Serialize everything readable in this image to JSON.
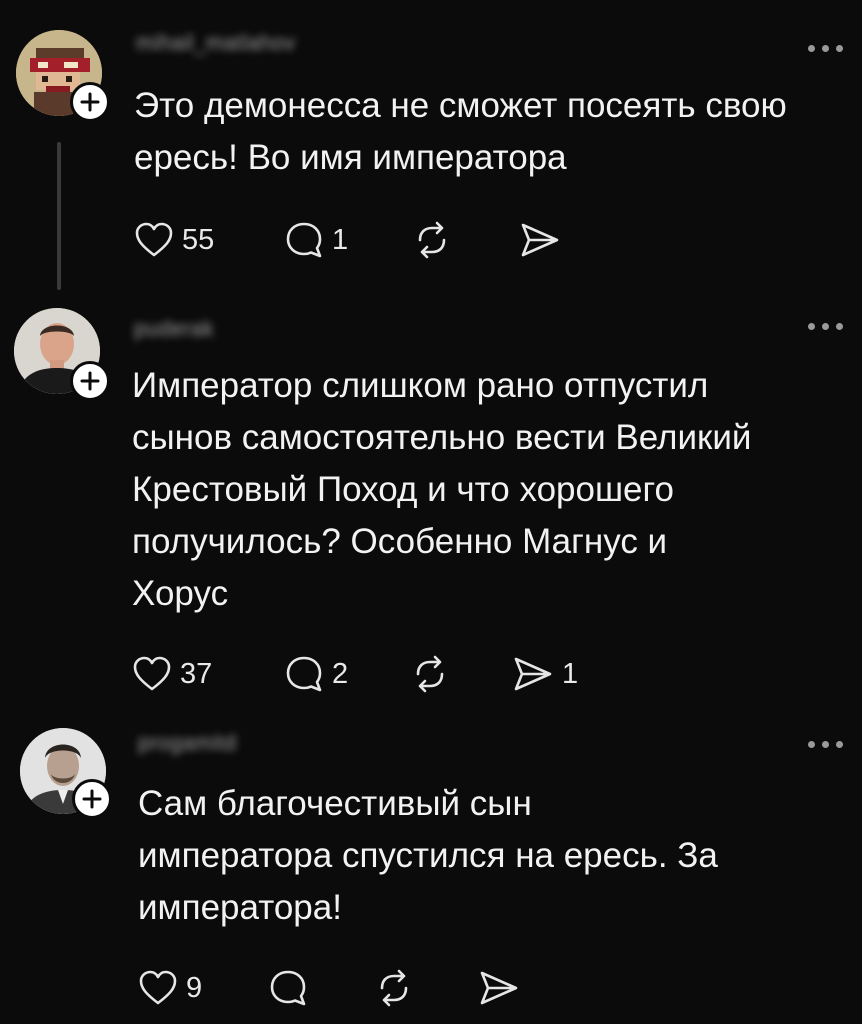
{
  "posts": [
    {
      "username": "mihail_matlahov",
      "text": "Это демонесса не сможет посеять свою\nересь! Во имя императора",
      "likes": "55",
      "comments": "1",
      "reposts": "",
      "shares": ""
    },
    {
      "username": "puderak",
      "text": "Император слишком рано отпустил\nсынов самостоятельно вести Великий\nКрестовый Поход и что хорошего\nполучилось? Особенно Магнус и\nХорус",
      "likes": "37",
      "comments": "2",
      "reposts": "",
      "shares": "1"
    },
    {
      "username": "progamitd",
      "text": "Сам благочестивый сын\nимператора спустился на ересь. За\nимператора!",
      "likes": "9",
      "comments": "",
      "reposts": "",
      "shares": ""
    }
  ],
  "icons": {
    "like": "heart-icon",
    "comment": "comment-bubble-icon",
    "repost": "repost-icon",
    "share": "send-icon",
    "follow": "plus-icon",
    "more": "more-dots-icon"
  },
  "colors": {
    "background": "#0b0b0b",
    "text": "#f2f2f2",
    "icon": "#e6e6e6",
    "thread_line": "#3a3a3a"
  }
}
